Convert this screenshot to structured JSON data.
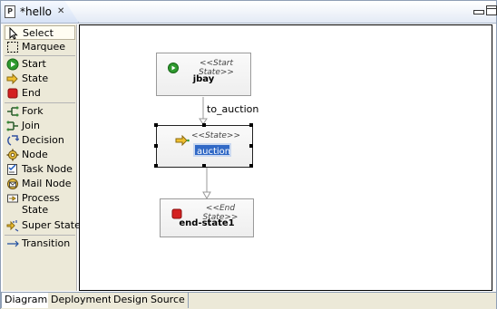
{
  "editor": {
    "tab_title": "*hello",
    "tab_icon_letter": "P"
  },
  "palette": {
    "items": [
      {
        "label": "Select",
        "icon": "arrow-cursor-icon"
      },
      {
        "label": "Marquee",
        "icon": "marquee-icon"
      },
      {
        "label": "Start",
        "icon": "start-state-icon"
      },
      {
        "label": "State",
        "icon": "state-icon"
      },
      {
        "label": "End",
        "icon": "end-state-icon"
      },
      {
        "label": "Fork",
        "icon": "fork-icon"
      },
      {
        "label": "Join",
        "icon": "join-icon"
      },
      {
        "label": "Decision",
        "icon": "decision-icon"
      },
      {
        "label": "Node",
        "icon": "node-gear-icon"
      },
      {
        "label": "Task Node",
        "icon": "task-node-icon"
      },
      {
        "label": "Mail Node",
        "icon": "mail-node-icon"
      },
      {
        "label": "Process State",
        "icon": "process-state-icon"
      },
      {
        "label": "Super State",
        "icon": "super-state-icon"
      },
      {
        "label": "Transition",
        "icon": "transition-arrow-icon"
      }
    ]
  },
  "diagram": {
    "start": {
      "stereotype": "<<Start State>>",
      "name": "jbay"
    },
    "transition_label": "to_auction",
    "state": {
      "stereotype": "<<State>>",
      "name": "auction"
    },
    "end": {
      "stereotype": "<<End State>>",
      "name": "end-state1"
    }
  },
  "bottom_tabs": [
    "Diagram",
    "Deployment",
    "Design",
    "Source"
  ],
  "colors": {
    "start_green": "#2e9a2e",
    "end_red": "#d42020",
    "edit_highlight": "#3169c6"
  }
}
